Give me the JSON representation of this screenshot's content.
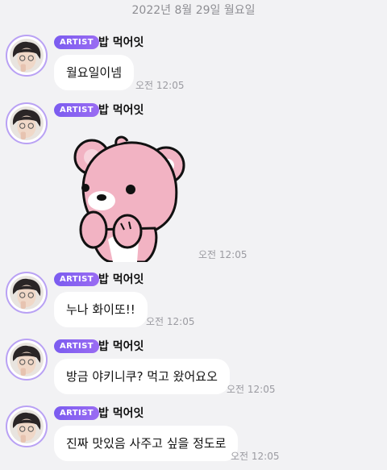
{
  "date_header": "2022년 8월 29일 월요일",
  "colors": {
    "accent": "#7b5cf0",
    "background": "#f2f2f4",
    "bubble": "#ffffff"
  },
  "messages": [
    {
      "badge": "ARTIST",
      "sender": "밥 먹어잇",
      "text": "월요일이넴",
      "time": "오전 12:05"
    },
    {
      "badge": "ARTIST",
      "sender": "밥 먹어잇",
      "sticker": "pink-bear-sticker-icon",
      "time": "오전 12:05"
    },
    {
      "badge": "ARTIST",
      "sender": "밥 먹어잇",
      "text": "누나 화이또!!",
      "time": "오전 12:05"
    },
    {
      "badge": "ARTIST",
      "sender": "밥 먹어잇",
      "text": "방금 야키니쿠? 먹고 왔어요오",
      "time": "오전 12:05"
    },
    {
      "badge": "ARTIST",
      "sender": "밥 먹어잇",
      "text": "진짜 맛있음 사주고 싶을 정도로",
      "time": "오전 12:05"
    }
  ]
}
